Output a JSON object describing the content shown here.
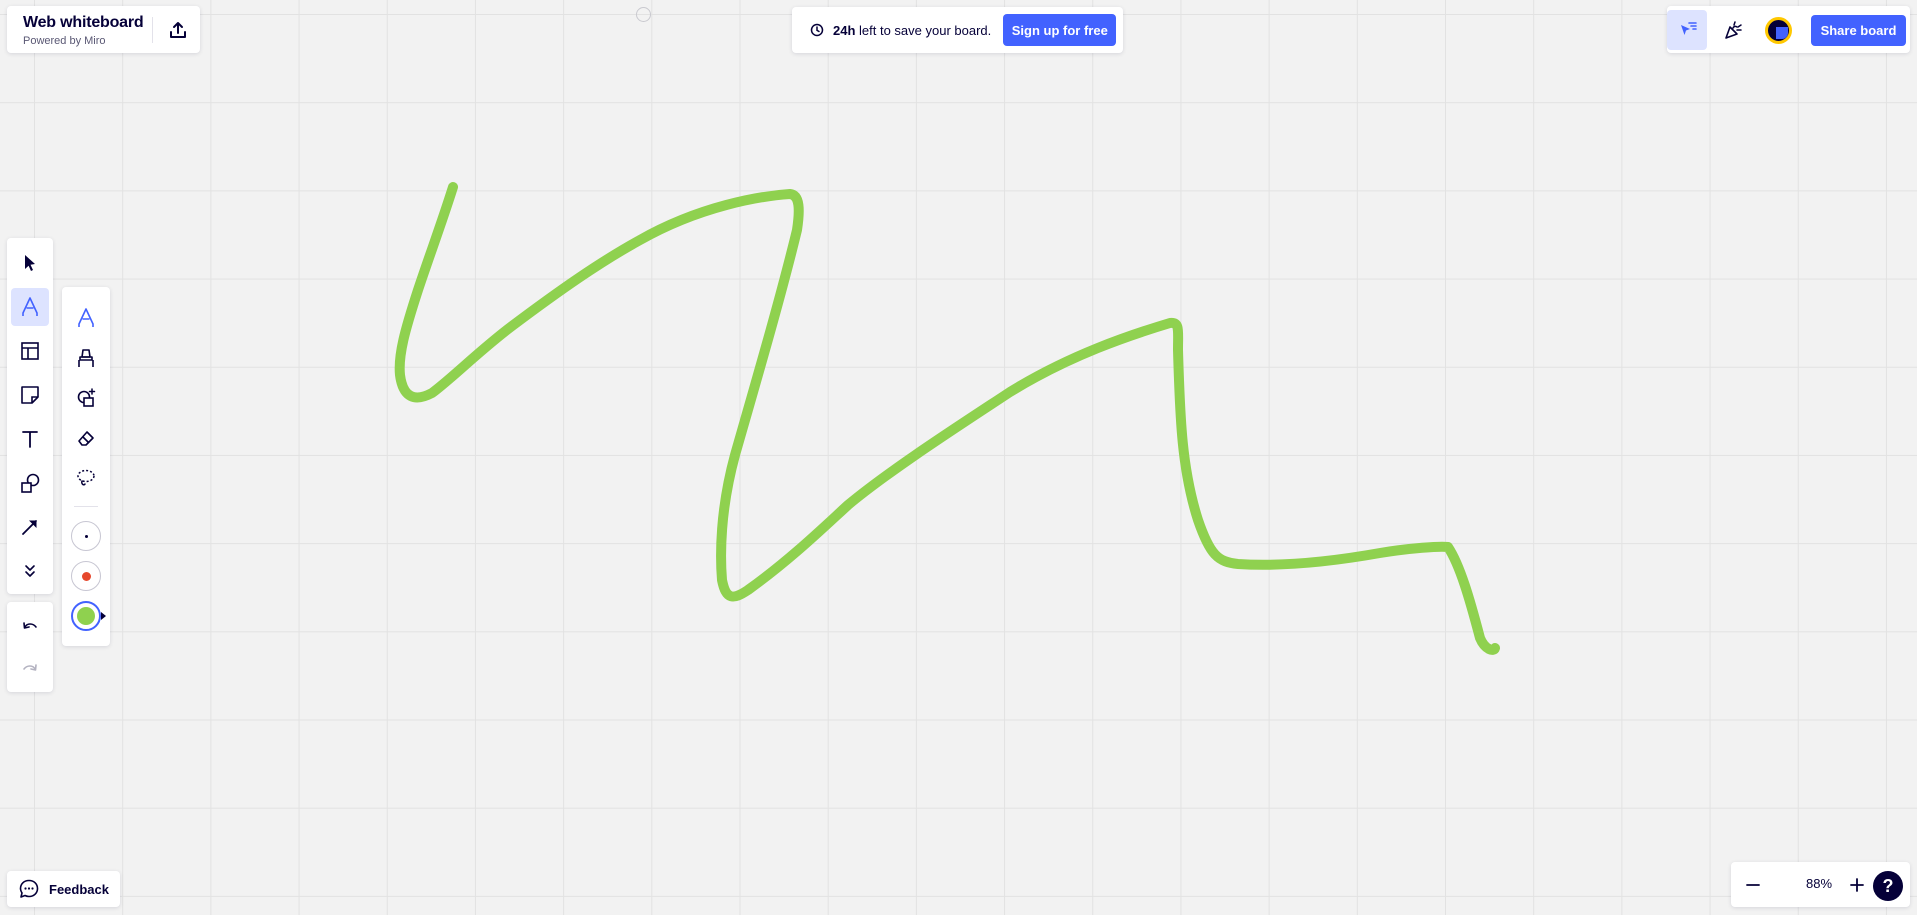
{
  "header": {
    "board_name": "Web whiteboard",
    "powered_by": "Powered by Miro",
    "export_icon": "export-icon"
  },
  "banner": {
    "time_left": "24h",
    "message": " left to save your board.",
    "signup_label": "Sign up for free",
    "clock_icon": "clock-icon"
  },
  "top_right": {
    "tools": [
      "cursor-filter-icon",
      "celebrate-icon"
    ],
    "share_label": "Share board"
  },
  "toolbar": {
    "tools": [
      {
        "name": "select",
        "icon": "select-cursor-icon",
        "active": false
      },
      {
        "name": "pen",
        "icon": "pen-icon",
        "active": true
      },
      {
        "name": "templates",
        "icon": "templates-icon",
        "active": false
      },
      {
        "name": "sticky-note",
        "icon": "sticky-note-icon",
        "active": false
      },
      {
        "name": "text",
        "icon": "text-icon",
        "active": false
      },
      {
        "name": "shapes",
        "icon": "shapes-icon",
        "active": false
      },
      {
        "name": "connector",
        "icon": "arrow-icon",
        "active": false
      },
      {
        "name": "more",
        "icon": "chevron-double-down-icon",
        "active": false
      }
    ],
    "undo_icon": "undo-icon",
    "redo_icon": "redo-icon"
  },
  "pen_panel": {
    "tools": [
      "pen-icon",
      "highlighter-icon",
      "smart-drawing-icon",
      "eraser-icon",
      "lasso-icon"
    ],
    "colors": [
      "#050038",
      "#e6482d",
      "#8fd14f"
    ],
    "selected_color": "#8fd14f"
  },
  "canvas": {
    "stroke_color": "#8fd14f"
  },
  "feedback": {
    "label": "Feedback",
    "icon": "feedback-icon"
  },
  "zoom": {
    "level": "88%",
    "help_label": "?"
  },
  "colors": {
    "accent": "#4262ff",
    "ink": "#050038",
    "board_bg": "#f2f2f2"
  }
}
